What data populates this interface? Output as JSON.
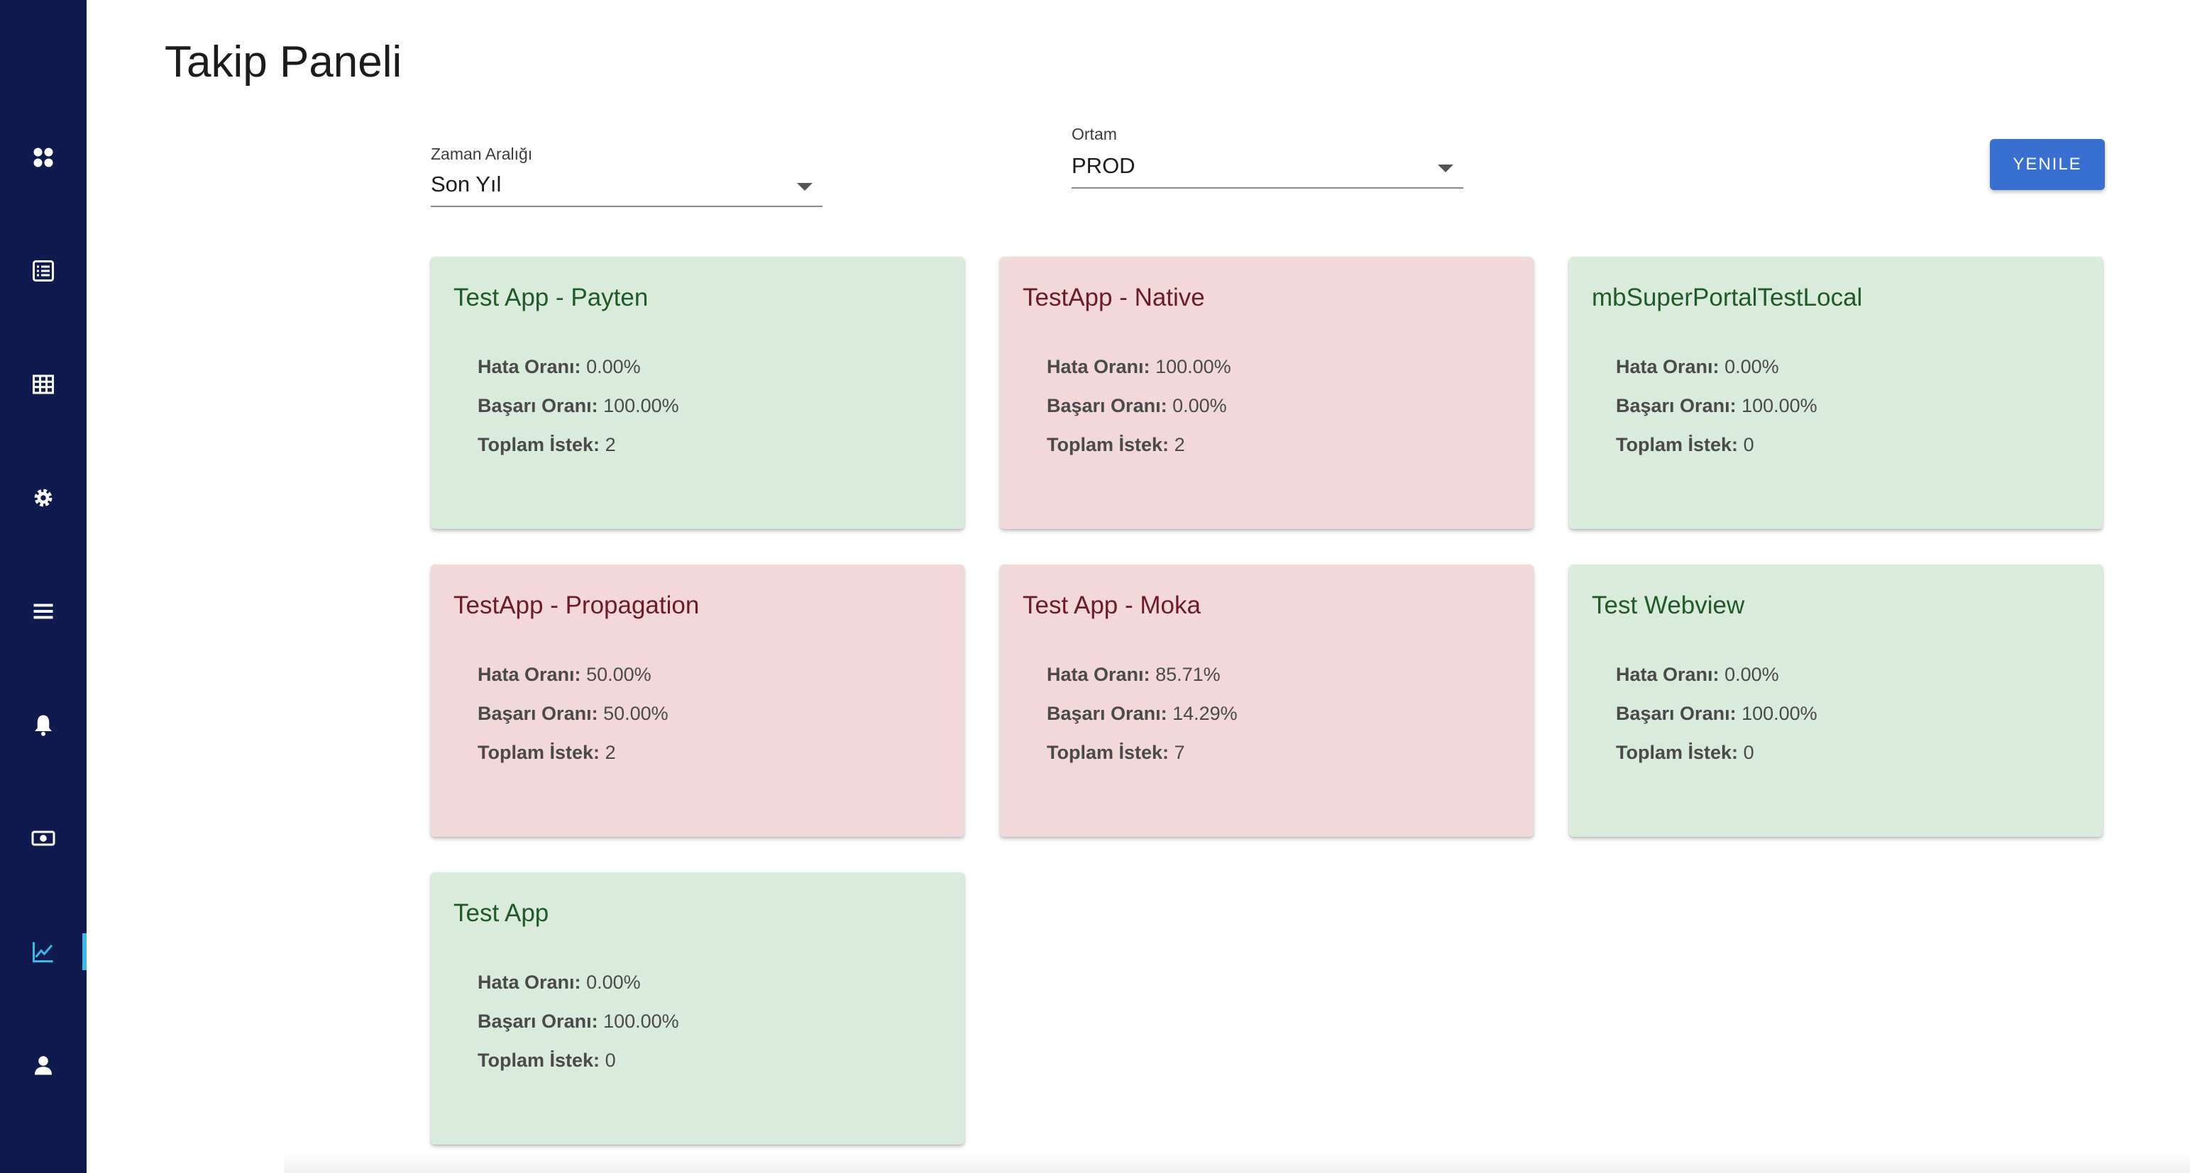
{
  "sidebar": {
    "items": [
      {
        "icon": "dashboard-icon"
      },
      {
        "icon": "list-icon"
      },
      {
        "icon": "table-icon"
      },
      {
        "icon": "gear-icon"
      },
      {
        "icon": "menu-icon"
      },
      {
        "icon": "bell-icon"
      },
      {
        "icon": "money-icon"
      },
      {
        "icon": "chart-icon",
        "active": true
      },
      {
        "icon": "user-icon"
      }
    ],
    "colors": {
      "background": "#0f1a4f",
      "icon": "#ffffff",
      "active_icon": "#3fb6e8"
    }
  },
  "page": {
    "title": "Takip Paneli"
  },
  "filters": {
    "time_range": {
      "label": "Zaman Aralığı",
      "value": "Son Yıl"
    },
    "environment": {
      "label": "Ortam",
      "value": "PROD"
    }
  },
  "toolbar": {
    "refresh_label": "YENILE"
  },
  "labels": {
    "error_rate": "Hata Oranı:",
    "success_rate": "Başarı Oranı:",
    "total_requests": "Toplam İstek:"
  },
  "cards": [
    {
      "name": "Test App - Payten",
      "status": "ok",
      "error_rate": "0.00%",
      "success_rate": "100.00%",
      "total_requests": "2"
    },
    {
      "name": "TestApp - Native",
      "status": "fail",
      "error_rate": "100.00%",
      "success_rate": "0.00%",
      "total_requests": "2"
    },
    {
      "name": "mbSuperPortalTestLocal",
      "status": "ok",
      "error_rate": "0.00%",
      "success_rate": "100.00%",
      "total_requests": "0"
    },
    {
      "name": "TestApp - Propagation",
      "status": "fail",
      "error_rate": "50.00%",
      "success_rate": "50.00%",
      "total_requests": "2"
    },
    {
      "name": "Test App - Moka",
      "status": "fail",
      "error_rate": "85.71%",
      "success_rate": "14.29%",
      "total_requests": "7"
    },
    {
      "name": "Test Webview",
      "status": "ok",
      "error_rate": "0.00%",
      "success_rate": "100.00%",
      "total_requests": "0"
    },
    {
      "name": "Test App",
      "status": "ok",
      "error_rate": "0.00%",
      "success_rate": "100.00%",
      "total_requests": "0"
    }
  ],
  "colors": {
    "ok_card": "#d9ebda",
    "fail_card": "#f3d8da",
    "ok_title": "#1f5a27",
    "fail_title": "#6b1c24",
    "button": "#3a6fd2"
  }
}
